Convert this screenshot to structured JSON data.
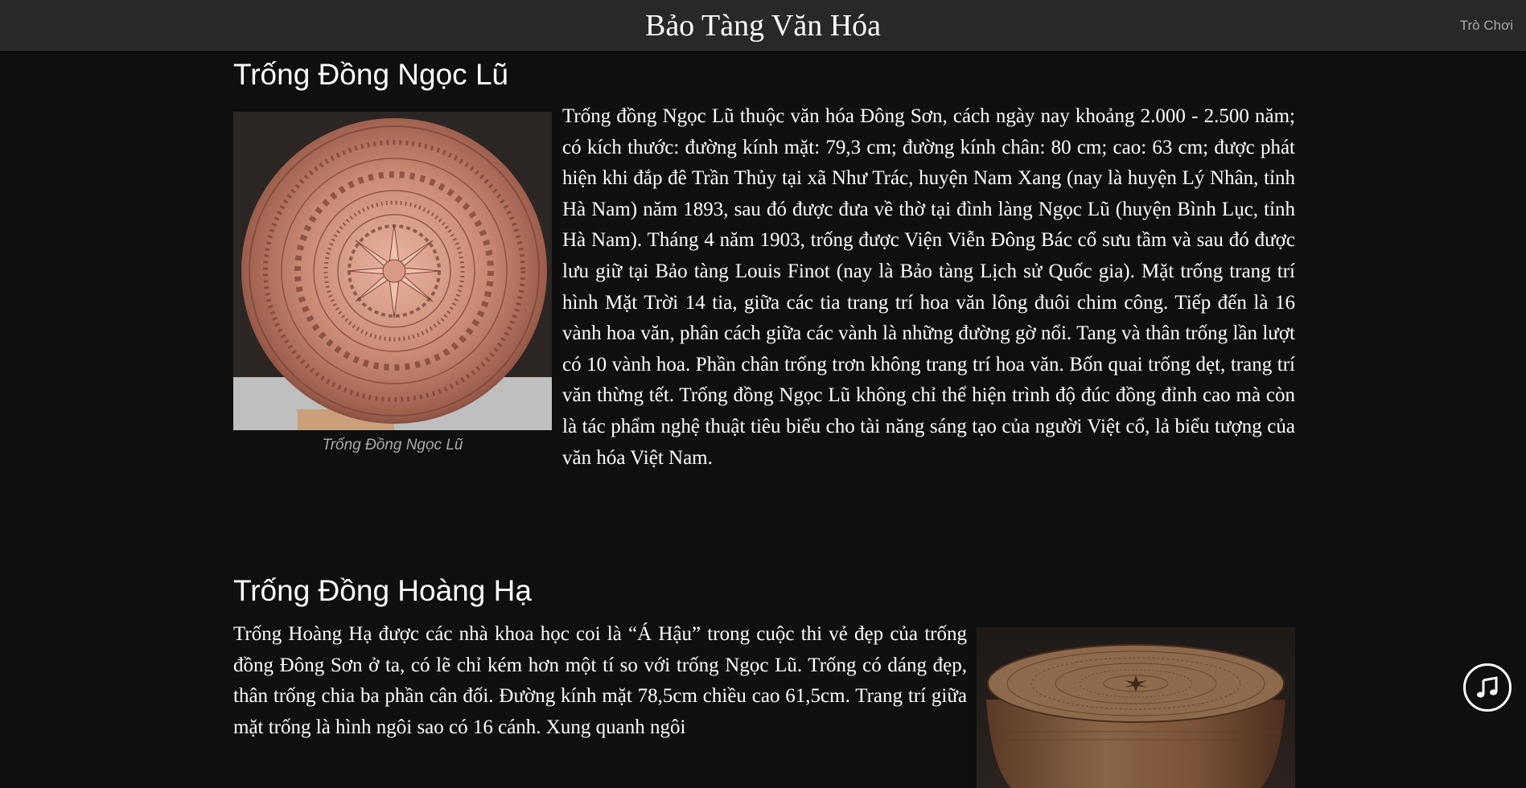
{
  "header": {
    "title": "Bảo Tàng Văn Hóa",
    "nav_link": "Trò Chơi"
  },
  "sections": [
    {
      "title": "Trống Đồng Ngọc Lũ",
      "image_icon": "bronze-drum-face-image",
      "caption": "Trống Đồng Ngọc Lũ",
      "text": "Trống đồng Ngọc Lũ thuộc văn hóa Đông Sơn, cách ngày nay khoảng 2.000 - 2.500 năm; có kích thước: đường kính mặt: 79,3 cm; đường kính chân: 80 cm; cao: 63 cm; được phát hiện khi đắp đê Trần Thủy tại xã Như Trác, huyện Nam Xang (nay là huyện Lý Nhân, tỉnh Hà Nam) năm 1893, sau đó được đưa về thờ tại đình làng Ngọc Lũ (huyện Bình Lục, tỉnh Hà Nam). Tháng 4 năm 1903, trống được Viện Viễn Đông Bác cổ sưu tầm và sau đó được lưu giữ tại Bảo tàng Louis Finot (nay là Bảo tàng Lịch sử Quốc gia). Mặt trống trang trí hình Mặt Trời 14 tia, giữa các tia trang trí hoa văn lông đuôi chim công. Tiếp đến là 16 vành hoa văn, phân cách giữa các vành là những đường gờ nổi. Tang và thân trống lần lượt có 10 vành hoa. Phần chân trống trơn không trang trí hoa văn. Bốn quai trống dẹt, trang trí văn thừng tết. Trống đồng Ngọc Lũ không chỉ thể hiện trình độ đúc đồng đỉnh cao mà còn là tác phẩm nghệ thuật tiêu biểu cho tài năng sáng tạo của người Việt cổ, lả biểu tượng của văn hóa Việt Nam."
    },
    {
      "title": "Trống Đồng Hoàng Hạ",
      "image_icon": "bronze-drum-side-image",
      "text": "Trống Hoàng Hạ được các nhà khoa học coi là “Á Hậu” trong cuộc thi vẻ đẹp của trống đồng Đông Sơn ở ta, có lẽ chỉ kém hơn một tí so với trống Ngọc Lũ. Trống có dáng đẹp, thân trống chia ba phần cân đối. Đường kính mặt 78,5cm chiều cao 61,5cm. Trang trí giữa mặt trống là hình ngôi sao có 16 cánh. Xung quanh ngôi"
    }
  ],
  "music_button": {
    "icon": "music-note-icon"
  },
  "colors": {
    "background": "#0f0f0f",
    "header": "#282828",
    "text": "#ffffff",
    "caption": "#aaaaaa",
    "bronze": "#c48a72"
  }
}
